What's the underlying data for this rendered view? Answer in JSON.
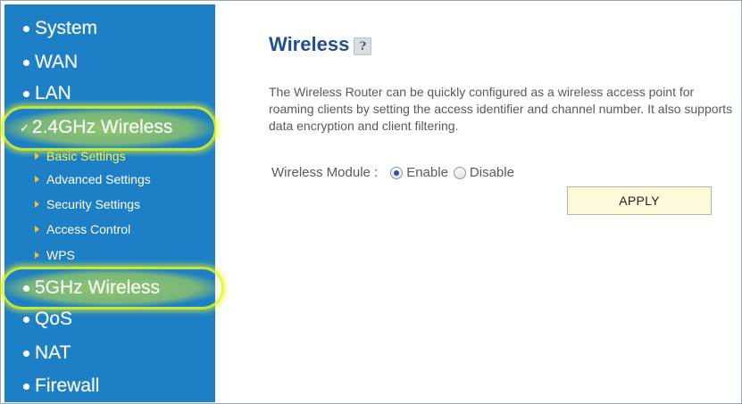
{
  "sidebar": {
    "items": [
      {
        "label": "System"
      },
      {
        "label": "WAN"
      },
      {
        "label": "LAN"
      },
      {
        "label": "2.4GHz Wireless",
        "highlighted": true,
        "expanded": true
      },
      {
        "label": "5GHz Wireless",
        "highlighted": true
      },
      {
        "label": "QoS"
      },
      {
        "label": "NAT"
      },
      {
        "label": "Firewall"
      }
    ],
    "subitems": [
      {
        "label": "Basic Settings",
        "active": true
      },
      {
        "label": "Advanced Settings"
      },
      {
        "label": "Security Settings"
      },
      {
        "label": "Access Control"
      },
      {
        "label": "WPS"
      }
    ],
    "bullet_icon": "dot-icon",
    "expanded_icon": "check-icon",
    "subitem_icon": "triangle-right-icon"
  },
  "main": {
    "title": "Wireless",
    "help_icon": "?",
    "description": "The Wireless Router can be quickly configured as a wireless access point for roaming clients by setting the access identifier and channel number. It also supports data encryption and client filtering.",
    "module": {
      "label": "Wireless Module :",
      "options": [
        {
          "label": "Enable",
          "selected": true
        },
        {
          "label": "Disable",
          "selected": false
        }
      ]
    },
    "apply_label": "APPLY"
  },
  "colors": {
    "sidebar_bg": "#1d7fc6",
    "highlight": "#e6fa28",
    "title": "#1f4f96",
    "active_subitem": "#f7f24a",
    "apply_bg": "#fdfbd9"
  }
}
